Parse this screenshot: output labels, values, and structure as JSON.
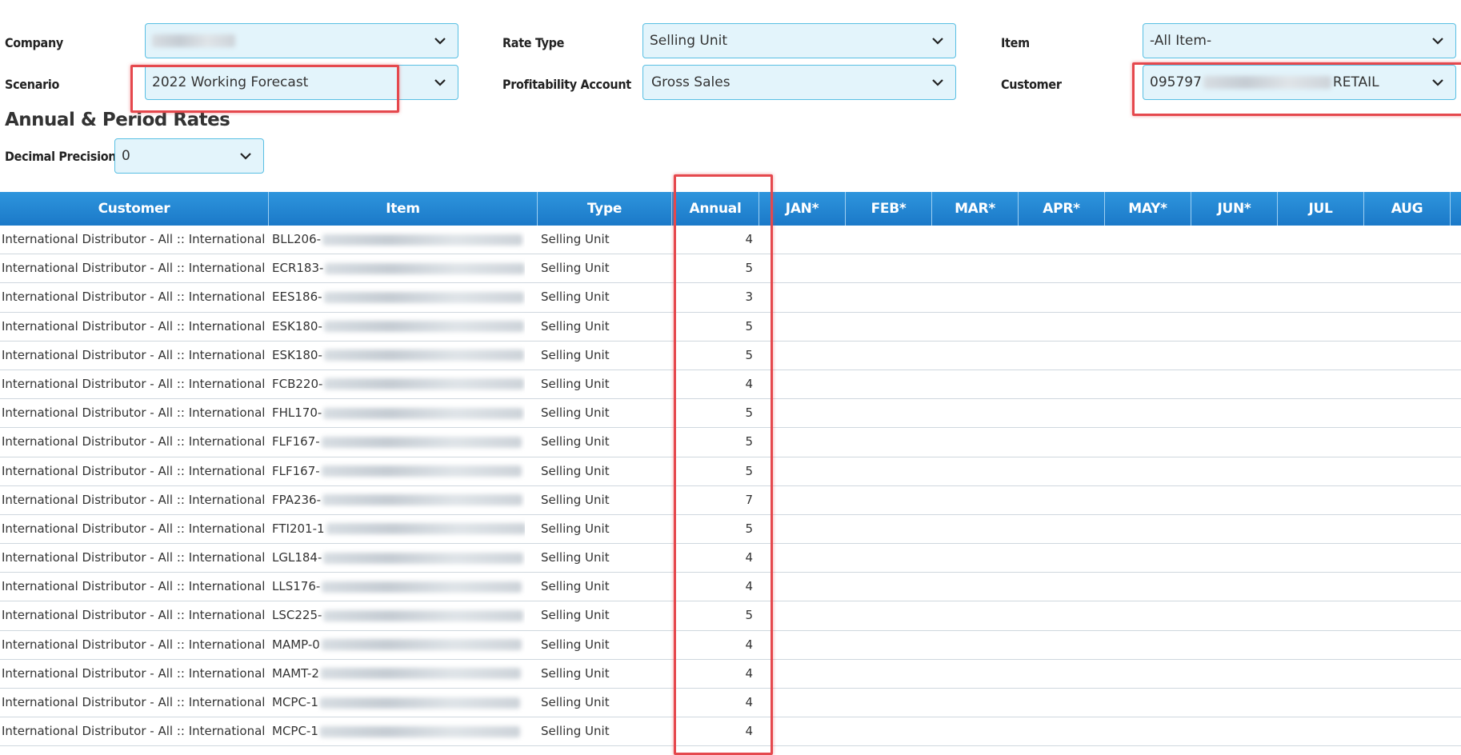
{
  "filters": {
    "company_label": "Company",
    "company_value": "",
    "scenario_label": "Scenario",
    "scenario_value": "2022 Working Forecast",
    "rate_type_label": "Rate Type",
    "rate_type_value": "Selling Unit",
    "profitability_label": "Profitability Account",
    "profitability_value": "Gross Sales",
    "item_label": "Item",
    "item_value": "-All Item-",
    "customer_label": "Customer",
    "customer_prefix": "095797",
    "customer_suffix": "RETAIL"
  },
  "section_title": "Annual & Period Rates",
  "decimal": {
    "label": "Decimal Precision",
    "value": "0"
  },
  "grid": {
    "columns": [
      "Customer",
      "Item",
      "Type",
      "Annual",
      "JAN*",
      "FEB*",
      "MAR*",
      "APR*",
      "MAY*",
      "JUN*",
      "JUL",
      "AUG"
    ],
    "rows": [
      {
        "customer": "International Distributor - All :: International :",
        "item": "BLL206-",
        "type": "Selling Unit",
        "annual": "4"
      },
      {
        "customer": "International Distributor - All :: International :",
        "item": "ECR183-",
        "type": "Selling Unit",
        "annual": "5"
      },
      {
        "customer": "International Distributor - All :: International :",
        "item": "EES186-",
        "type": "Selling Unit",
        "annual": "3"
      },
      {
        "customer": "International Distributor - All :: International :",
        "item": "ESK180-",
        "type": "Selling Unit",
        "annual": "5"
      },
      {
        "customer": "International Distributor - All :: International :",
        "item": "ESK180-",
        "type": "Selling Unit",
        "annual": "5"
      },
      {
        "customer": "International Distributor - All :: International :",
        "item": "FCB220-",
        "type": "Selling Unit",
        "annual": "4"
      },
      {
        "customer": "International Distributor - All :: International :",
        "item": "FHL170-",
        "type": "Selling Unit",
        "annual": "5"
      },
      {
        "customer": "International Distributor - All :: International :",
        "item": "FLF167-",
        "type": "Selling Unit",
        "annual": "5"
      },
      {
        "customer": "International Distributor - All :: International :",
        "item": "FLF167-",
        "type": "Selling Unit",
        "annual": "5"
      },
      {
        "customer": "International Distributor - All :: International :",
        "item": "FPA236-",
        "type": "Selling Unit",
        "annual": "7"
      },
      {
        "customer": "International Distributor - All :: International :",
        "item": "FTI201-1",
        "type": "Selling Unit",
        "annual": "5"
      },
      {
        "customer": "International Distributor - All :: International :",
        "item": "LGL184-",
        "type": "Selling Unit",
        "annual": "4"
      },
      {
        "customer": "International Distributor - All :: International :",
        "item": "LLS176-",
        "type": "Selling Unit",
        "annual": "4"
      },
      {
        "customer": "International Distributor - All :: International :",
        "item": "LSC225-",
        "type": "Selling Unit",
        "annual": "5"
      },
      {
        "customer": "International Distributor - All :: International :",
        "item": "MAMP-0",
        "type": "Selling Unit",
        "annual": "4"
      },
      {
        "customer": "International Distributor - All :: International :",
        "item": "MAMT-2",
        "type": "Selling Unit",
        "annual": "4"
      },
      {
        "customer": "International Distributor - All :: International :",
        "item": "MCPC-1",
        "type": "Selling Unit",
        "annual": "4"
      },
      {
        "customer": "International Distributor - All :: International :",
        "item": "MCPC-1",
        "type": "Selling Unit",
        "annual": "4"
      }
    ]
  },
  "colors": {
    "header_bg": "#1b79c8",
    "select_bg": "#e3f4fb",
    "select_border": "#58bfe3",
    "highlight": "#e5484d"
  }
}
